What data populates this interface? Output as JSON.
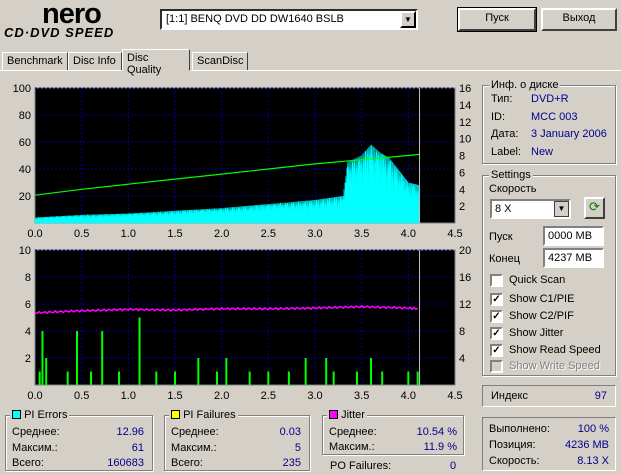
{
  "logo": {
    "top": "nero",
    "bottom": "CD·DVD SPEED"
  },
  "drive": {
    "selected": "[1:1]  BENQ DVD DD DW1640 BSLB"
  },
  "buttons": {
    "start": "Пуск",
    "exit": "Выход"
  },
  "tabs": [
    {
      "label": "Benchmark"
    },
    {
      "label": "Disc Info"
    },
    {
      "label": "Disc Quality"
    },
    {
      "label": "ScanDisc"
    }
  ],
  "disc_info": {
    "title": "Инф. о диске",
    "type_label": "Тип:",
    "type": "DVD+R",
    "id_label": "ID:",
    "id": "MCC 003",
    "date_label": "Дата:",
    "date": "3 January 2006",
    "label_label": "Label:",
    "label": "New"
  },
  "settings": {
    "title": "Settings",
    "speed_label": "Скорость",
    "speed": "8 X",
    "start_label": "Пуск",
    "start": "0000 MB",
    "end_label": "Конец",
    "end": "4237 MB",
    "checks": [
      {
        "label": "Quick Scan",
        "checked": false,
        "disabled": false
      },
      {
        "label": "Show C1/PIE",
        "checked": true,
        "disabled": false
      },
      {
        "label": "Show C2/PIF",
        "checked": true,
        "disabled": false
      },
      {
        "label": "Show Jitter",
        "checked": true,
        "disabled": false
      },
      {
        "label": "Show Read Speed",
        "checked": true,
        "disabled": false
      },
      {
        "label": "Show Write Speed",
        "checked": false,
        "disabled": true
      }
    ]
  },
  "index": {
    "label": "Индекс",
    "value": "97"
  },
  "pi_errors": {
    "title": "PI Errors",
    "color": "#00ffff",
    "avg_label": "Среднее:",
    "avg": "12.96",
    "max_label": "Максим.:",
    "max": "61",
    "total_label": "Всего:",
    "total": "160683"
  },
  "pi_failures": {
    "title": "PI Failures",
    "color": "#ffff00",
    "avg_label": "Среднее:",
    "avg": "0.03",
    "max_label": "Максим.:",
    "max": "5",
    "total_label": "Всего:",
    "total": "235"
  },
  "jitter": {
    "title": "Jitter",
    "color": "#ff00ff",
    "avg_label": "Среднее:",
    "avg": "10.54 %",
    "max_label": "Максим.:",
    "max": "11.9 %",
    "po_label": "PO Failures:",
    "po": "0"
  },
  "progress": {
    "done_label": "Выполнено:",
    "done": "100 %",
    "pos_label": "Позиция:",
    "pos": "4236 MB",
    "speed_label": "Скорость:",
    "speed": "8.13 X"
  },
  "chart_data": [
    {
      "type": "area",
      "xlim": [
        0,
        4.5
      ],
      "ylim": [
        0,
        100
      ],
      "y2lim": [
        0,
        16
      ],
      "x_ticks": [
        "0.0",
        "0.5",
        "1.0",
        "1.5",
        "2.0",
        "2.5",
        "3.0",
        "3.5",
        "4.0",
        "4.5"
      ],
      "y_ticks": [
        "100",
        "80",
        "60",
        "40",
        "20"
      ],
      "y2_ticks": [
        "16",
        "14",
        "12",
        "10",
        "8",
        "6",
        "4",
        "2"
      ],
      "series": [
        {
          "values": [
            [
              0,
              4
            ],
            [
              0.5,
              6
            ],
            [
              1.0,
              7
            ],
            [
              1.5,
              9
            ],
            [
              2.0,
              11
            ],
            [
              2.5,
              14
            ],
            [
              3.0,
              17
            ],
            [
              3.3,
              20
            ],
            [
              3.35,
              45
            ],
            [
              3.5,
              50
            ],
            [
              3.6,
              58
            ],
            [
              3.7,
              52
            ],
            [
              3.8,
              48
            ],
            [
              4.0,
              30
            ],
            [
              4.12,
              28
            ]
          ]
        },
        {
          "values": [
            [
              0,
              3.3
            ],
            [
              0.5,
              4.0
            ],
            [
              1.0,
              4.6
            ],
            [
              1.5,
              5.2
            ],
            [
              2.0,
              5.8
            ],
            [
              2.5,
              6.4
            ],
            [
              3.0,
              7.0
            ],
            [
              3.5,
              7.5
            ],
            [
              4.0,
              8.0
            ],
            [
              4.12,
              8.13
            ]
          ]
        }
      ],
      "marker_x": 4.12
    },
    {
      "type": "bar",
      "xlim": [
        0,
        4.5
      ],
      "ylim": [
        0,
        10
      ],
      "y2lim": [
        0,
        20
      ],
      "x_ticks": [
        "0.0",
        "0.5",
        "1.0",
        "1.5",
        "2.0",
        "2.5",
        "3.0",
        "3.5",
        "4.0",
        "4.5"
      ],
      "y_ticks": [
        "10",
        "8",
        "6",
        "4",
        "2"
      ],
      "y2_ticks": [
        "20",
        "16",
        "12",
        "8",
        "4"
      ],
      "series": [
        {
          "values": [
            [
              0.05,
              1
            ],
            [
              0.08,
              4
            ],
            [
              0.12,
              2
            ],
            [
              0.35,
              1
            ],
            [
              0.45,
              4
            ],
            [
              0.6,
              1
            ],
            [
              0.72,
              4
            ],
            [
              0.9,
              1
            ],
            [
              1.12,
              5
            ],
            [
              1.3,
              1
            ],
            [
              1.5,
              1
            ],
            [
              1.75,
              2
            ],
            [
              1.95,
              1
            ],
            [
              2.05,
              2
            ],
            [
              2.3,
              1
            ],
            [
              2.5,
              1
            ],
            [
              2.72,
              1
            ],
            [
              2.9,
              2
            ],
            [
              3.12,
              2
            ],
            [
              3.2,
              1
            ],
            [
              3.45,
              1
            ],
            [
              3.6,
              2
            ],
            [
              3.72,
              1
            ],
            [
              4.0,
              1
            ],
            [
              4.1,
              1
            ]
          ]
        },
        {
          "values": [
            [
              0,
              10.7
            ],
            [
              0.5,
              11.0
            ],
            [
              1.0,
              11.2
            ],
            [
              1.5,
              11.1
            ],
            [
              2.0,
              11.3
            ],
            [
              2.5,
              11.3
            ],
            [
              3.0,
              11.4
            ],
            [
              3.5,
              11.6
            ],
            [
              4.0,
              11.4
            ],
            [
              4.12,
              11.3
            ]
          ]
        }
      ],
      "marker_x": 4.12
    }
  ]
}
